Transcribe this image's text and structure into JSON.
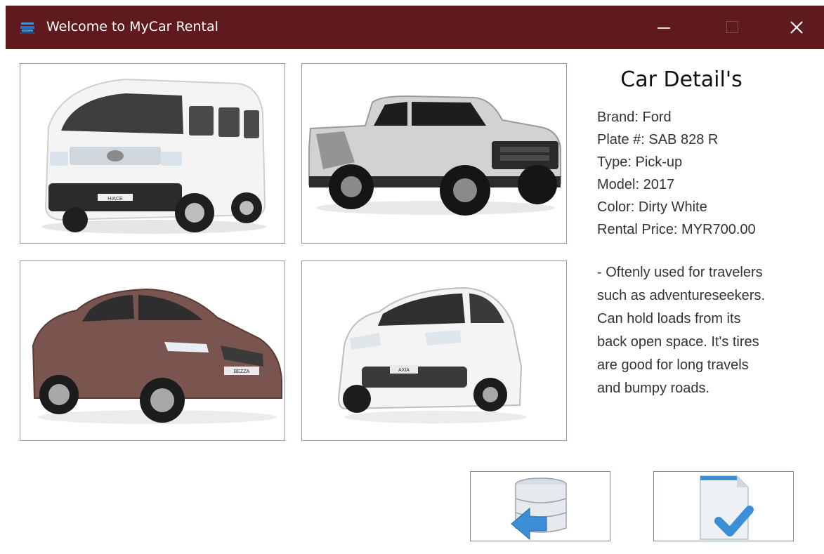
{
  "window": {
    "title": "Welcome to MyCar Rental",
    "titlebar_color": "#5e1a1d",
    "icons": {
      "app": "car-app-icon",
      "minimize": "minimize-icon",
      "maximize": "maximize-icon",
      "close": "close-icon"
    }
  },
  "gallery": {
    "cars": [
      {
        "name": "car-image-van",
        "badge": "HIACE",
        "color": "#f2f2f2"
      },
      {
        "name": "car-image-pickup",
        "color": "#cfcfcf"
      },
      {
        "name": "car-image-sedan",
        "badge": "BEZZA",
        "color": "#7a5550"
      },
      {
        "name": "car-image-hatchback",
        "badge": "AXIA",
        "color": "#f4f4f4"
      }
    ]
  },
  "details": {
    "heading": "Car Detail's",
    "brand": "Brand: Ford",
    "plate": "Plate #: SAB 828 R",
    "type": "Type: Pick-up",
    "model": "Model: 2017",
    "color": "Color: Dirty White",
    "price": "Rental Price: MYR700.00",
    "description_lines": [
      "- Oftenly used for travelers",
      "such as adventureseekers.",
      "Can hold loads from its",
      "back open space. It's tires",
      "are good for long travels",
      "and bumpy roads."
    ]
  },
  "actions": {
    "back_icon": "database-back-icon",
    "confirm_icon": "document-check-icon"
  }
}
